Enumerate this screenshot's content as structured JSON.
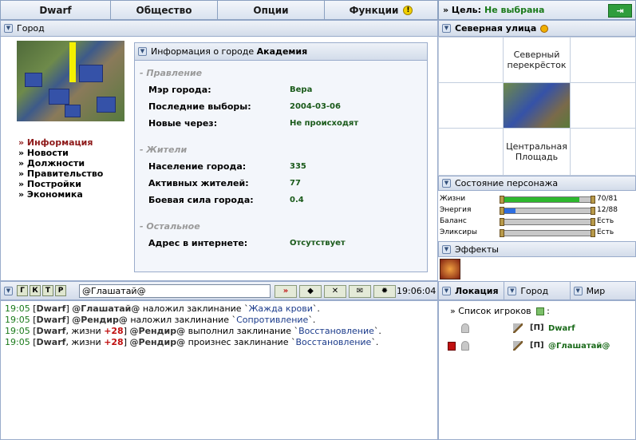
{
  "topmenu": {
    "items": [
      "Dwarf",
      "Общество",
      "Опции",
      "Функции"
    ],
    "warning_glyph": "!"
  },
  "goal": {
    "label": "» Цель:",
    "value": "Не выбрана"
  },
  "city_panel": {
    "title": "Город",
    "nav": [
      "» Информация",
      "» Новости",
      "» Должности",
      "» Правительство",
      "» Постройки",
      "» Экономика"
    ],
    "info": {
      "title_prefix": "Информация о городе",
      "city_name": "Академия",
      "groups": [
        {
          "name": "- Правление",
          "rows": [
            {
              "label": "Мэр города:",
              "value": "Вера"
            },
            {
              "label": "Последние выборы:",
              "value": "2004-03-06"
            },
            {
              "label": "Новые через:",
              "value": "Не происходят"
            }
          ]
        },
        {
          "name": "- Жители",
          "rows": [
            {
              "label": "Население города:",
              "value": "335"
            },
            {
              "label": "Активных жителей:",
              "value": "77"
            },
            {
              "label": "Боевая сила города:",
              "value": "0.4"
            }
          ]
        },
        {
          "name": "- Остальное",
          "rows": [
            {
              "label": "Адрес в интернете:",
              "value": "Отсутствует"
            }
          ]
        }
      ]
    }
  },
  "street": {
    "title": "Северная улица",
    "north": "Северный перекрёсток",
    "south": "Центральная Площадь"
  },
  "status": {
    "title": "Состояние персонажа",
    "rows": [
      {
        "label": "Жизни",
        "value": "70/81",
        "fill": 0.86,
        "color": "#2eb82e"
      },
      {
        "label": "Энергия",
        "value": "12/88",
        "fill": 0.14,
        "color": "#2e6ee0"
      },
      {
        "label": "Баланс",
        "value": "Есть",
        "fill": 0,
        "color": "#999999"
      },
      {
        "label": "Эликсиры",
        "value": "Есть",
        "fill": 0,
        "color": "#999999"
      }
    ]
  },
  "effects": {
    "title": "Эффекты"
  },
  "chat": {
    "buttons": [
      "Г",
      "К",
      "Т",
      "Р"
    ],
    "input_value": "@Глашатай@",
    "send_glyph": "»",
    "clock": "19:06:04",
    "lines": [
      {
        "time": "19:05",
        "who": "Dwarf",
        "extra": "",
        "plus": "",
        "target": "@Глашатай@",
        "action": "наложил заклинание",
        "spell": "Жажда крови",
        "end": "."
      },
      {
        "time": "19:05",
        "who": "Dwarf",
        "extra": "",
        "plus": "",
        "target": "@Рендир@",
        "action": "наложил заклинание",
        "spell": "Сопротивление",
        "end": "."
      },
      {
        "time": "19:05",
        "who": "Dwarf",
        "extra": ", жизни",
        "plus": "+28",
        "target": "@Рендир@",
        "action": "выполнил заклинание",
        "spell": "Восстановление",
        "end": "."
      },
      {
        "time": "19:05",
        "who": "Dwarf",
        "extra": ", жизни",
        "plus": "+28",
        "target": "@Рендир@",
        "action": "произнес заклинание",
        "spell": "Восстановление",
        "end": "."
      }
    ]
  },
  "location": {
    "tabs": [
      "Локация",
      "Город",
      "Мир"
    ],
    "list_title": "» Список игроков",
    "list_colon": ":",
    "players": [
      {
        "clan": "[П]",
        "name": "Dwarf",
        "flag": false
      },
      {
        "clan": "[П]",
        "name": "@Глашатай@",
        "flag": true
      }
    ]
  },
  "colors": {
    "accent_green": "#1a7a1a",
    "panel_border": "#9aaccb",
    "active_nav": "#8e1a1a"
  }
}
